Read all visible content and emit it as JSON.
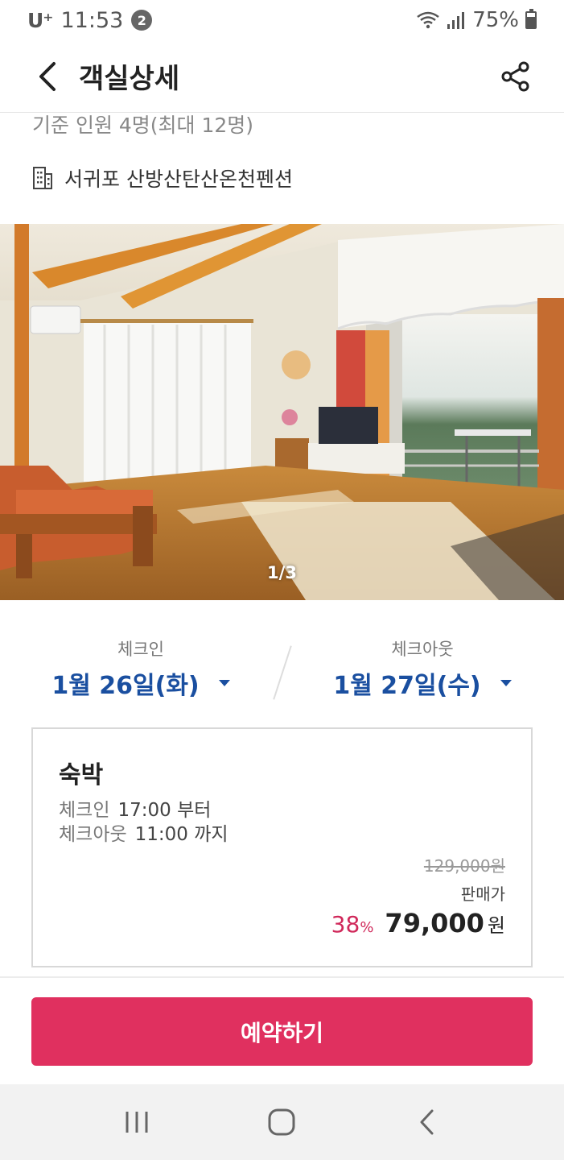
{
  "status_bar": {
    "carrier": "U⁺",
    "time": "11:53",
    "notification_count": "2",
    "battery": "75%"
  },
  "header": {
    "title": "객실상세",
    "back_icon": "chevron-left-icon",
    "share_icon": "share-icon"
  },
  "room": {
    "capacity": "기준 인원 4명(최대 12명)",
    "property_name": "서귀포 산방산탄산온천펜션",
    "property_icon": "building-icon"
  },
  "photo": {
    "counter": "1/3"
  },
  "dates": {
    "checkin_label": "체크인",
    "checkin_value": "1월 26일(화)",
    "checkout_label": "체크아웃",
    "checkout_value": "1월 27일(수)"
  },
  "stay": {
    "title": "숙박",
    "checkin_label": "체크인",
    "checkin_time": "17:00 부터",
    "checkout_label": "체크아웃",
    "checkout_time": "11:00 까지",
    "original_price": "129,000원",
    "sale_label": "판매가",
    "discount": "38",
    "discount_unit": "%",
    "final_price": "79,000",
    "currency": "원"
  },
  "reserve_button": "예약하기",
  "colors": {
    "accent": "#e0305f",
    "date_blue": "#1a4fa0",
    "discount": "#d0285a"
  }
}
